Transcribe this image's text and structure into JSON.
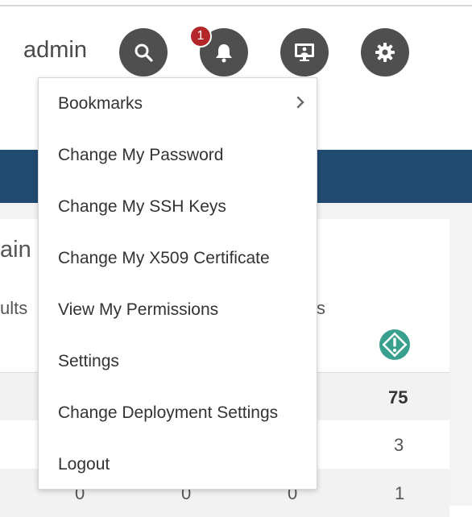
{
  "header": {
    "username": "admin",
    "notification_count": "1",
    "buttons": [
      {
        "name": "search-button",
        "icon": "search-icon"
      },
      {
        "name": "notifications-button",
        "icon": "bell-icon"
      },
      {
        "name": "display-button",
        "icon": "monitor-icon"
      },
      {
        "name": "settings-button",
        "icon": "gear-icon"
      }
    ]
  },
  "colors": {
    "header_button_bg": "#4f4f4f",
    "badge_bg": "#b3262a",
    "band_bg": "#214b70",
    "alert_icon": "#3aa08e"
  },
  "background": {
    "partial_title": "ain",
    "partial_label_left": "ults",
    "partial_label_right": "s",
    "alert_icon": "alert-diamond-icon",
    "rows": [
      {
        "last": "75"
      },
      {
        "last": "3"
      },
      {
        "cells": [
          "0",
          "0",
          "0"
        ],
        "last": "1"
      }
    ]
  },
  "user_menu": {
    "items": [
      {
        "label": "Bookmarks",
        "has_submenu": true
      },
      {
        "label": "Change My Password"
      },
      {
        "label": "Change My SSH Keys"
      },
      {
        "label": "Change My X509 Certificate"
      },
      {
        "label": "View My Permissions"
      },
      {
        "label": "Settings"
      },
      {
        "label": "Change Deployment Settings"
      },
      {
        "label": "Logout"
      }
    ]
  }
}
